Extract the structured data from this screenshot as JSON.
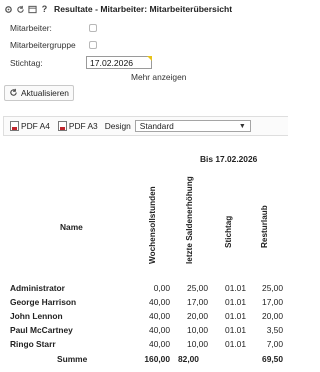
{
  "window": {
    "title": "Resultate - Mitarbeiter: Mitarbeiterübersicht"
  },
  "filters": {
    "employee_label": "Mitarbeiter:",
    "group_label": "Mitarbeitergruppe",
    "date_label": "Stichtag:",
    "date_value": "17.02.2026",
    "more_label": "Mehr anzeigen",
    "refresh_label": "Aktualisieren"
  },
  "toolbar": {
    "pdf_a4": "PDF A4",
    "pdf_a3": "PDF A3",
    "design_label": "Design",
    "design_value": "Standard"
  },
  "report": {
    "period": "Bis 17.02.2026",
    "name_header": "Name",
    "columns": [
      "Wochensollstunden",
      "letzte Saldenerhöhung",
      "Stichtag",
      "Resturlaub"
    ],
    "rows": [
      {
        "name": "Administrator",
        "values": [
          "0,00",
          "25,00",
          "01.01",
          "25,00"
        ]
      },
      {
        "name": "George Harrison",
        "values": [
          "40,00",
          "17,00",
          "01.01",
          "17,00"
        ]
      },
      {
        "name": "John Lennon",
        "values": [
          "40,00",
          "20,00",
          "01.01",
          "20,00"
        ]
      },
      {
        "name": "Paul McCartney",
        "values": [
          "40,00",
          "10,00",
          "01.01",
          "3,50"
        ]
      },
      {
        "name": "Ringo Starr",
        "values": [
          "40,00",
          "10,00",
          "01.01",
          "7,00"
        ]
      }
    ],
    "sum": {
      "label": "Summe",
      "values": [
        "160,00",
        "82,00",
        "",
        "69,50"
      ]
    }
  }
}
